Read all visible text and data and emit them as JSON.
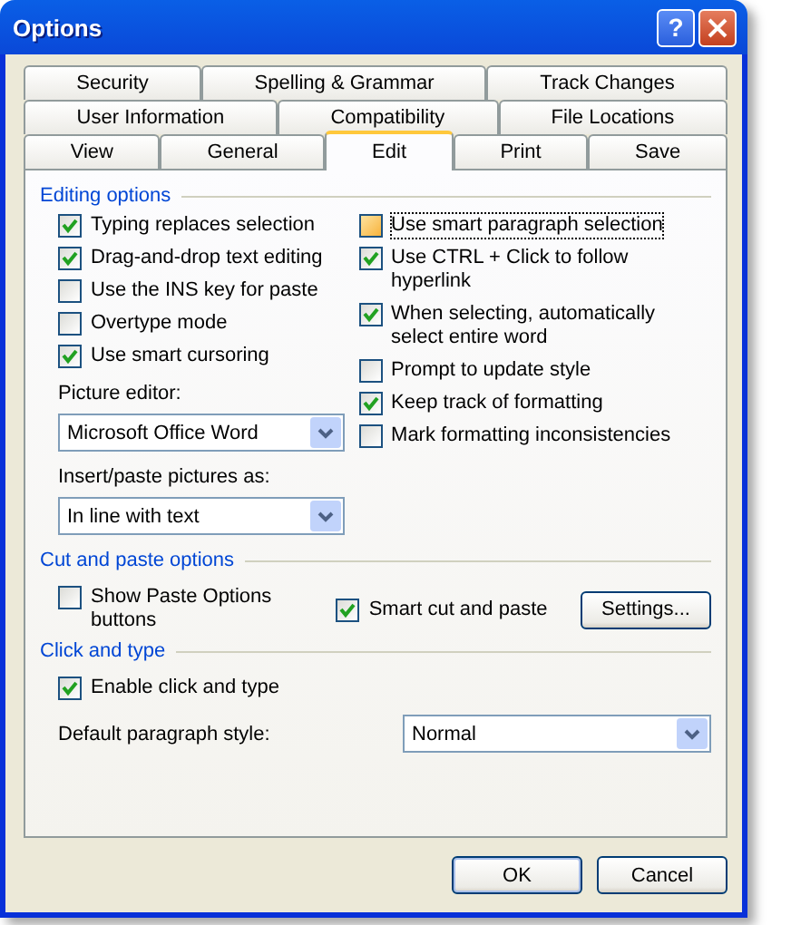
{
  "window": {
    "title": "Options",
    "help_button": "?"
  },
  "tab_rows": [
    [
      {
        "label": "Security",
        "selected": false
      },
      {
        "label": "Spelling & Grammar",
        "selected": false
      },
      {
        "label": "Track Changes",
        "selected": false
      }
    ],
    [
      {
        "label": "User Information",
        "selected": false
      },
      {
        "label": "Compatibility",
        "selected": false
      },
      {
        "label": "File Locations",
        "selected": false
      }
    ],
    [
      {
        "label": "View",
        "selected": false
      },
      {
        "label": "General",
        "selected": false
      },
      {
        "label": "Edit",
        "selected": true
      },
      {
        "label": "Print",
        "selected": false
      },
      {
        "label": "Save",
        "selected": false
      }
    ]
  ],
  "editing_options": {
    "heading": "Editing options",
    "left": [
      {
        "label": "Typing replaces selection",
        "checked": true,
        "focused": false
      },
      {
        "label": "Drag-and-drop text editing",
        "checked": true,
        "focused": false
      },
      {
        "label": "Use the INS key for paste",
        "checked": false,
        "focused": false
      },
      {
        "label": "Overtype mode",
        "checked": false,
        "focused": false
      },
      {
        "label": "Use smart cursoring",
        "checked": true,
        "focused": false
      }
    ],
    "picture_editor": {
      "label": "Picture editor:",
      "value": "Microsoft Office Word"
    },
    "insert_paste": {
      "label": "Insert/paste pictures as:",
      "value": "In line with text"
    },
    "right": [
      {
        "label": "Use smart paragraph selection",
        "checked": false,
        "focused": true
      },
      {
        "label": "Use CTRL + Click to follow hyperlink",
        "checked": true,
        "focused": false
      },
      {
        "label": "When selecting, automatically select entire word",
        "checked": true,
        "focused": false
      },
      {
        "label": "Prompt to update style",
        "checked": false,
        "focused": false
      },
      {
        "label": "Keep track of formatting",
        "checked": true,
        "focused": false
      },
      {
        "label": "Mark formatting inconsistencies",
        "checked": false,
        "focused": false
      }
    ]
  },
  "cut_and_paste": {
    "heading": "Cut and paste options",
    "checkboxes": [
      {
        "label": "Show Paste Options buttons",
        "checked": false,
        "focused": false
      },
      {
        "label": "Smart cut and paste",
        "checked": true,
        "focused": false
      }
    ],
    "settings_button": "Settings..."
  },
  "click_and_type": {
    "heading": "Click and type",
    "checkbox": {
      "label": "Enable click and type",
      "checked": true,
      "focused": false
    },
    "default_style": {
      "label": "Default paragraph style:",
      "value": "Normal"
    }
  },
  "buttons": [
    "OK",
    "Cancel"
  ]
}
